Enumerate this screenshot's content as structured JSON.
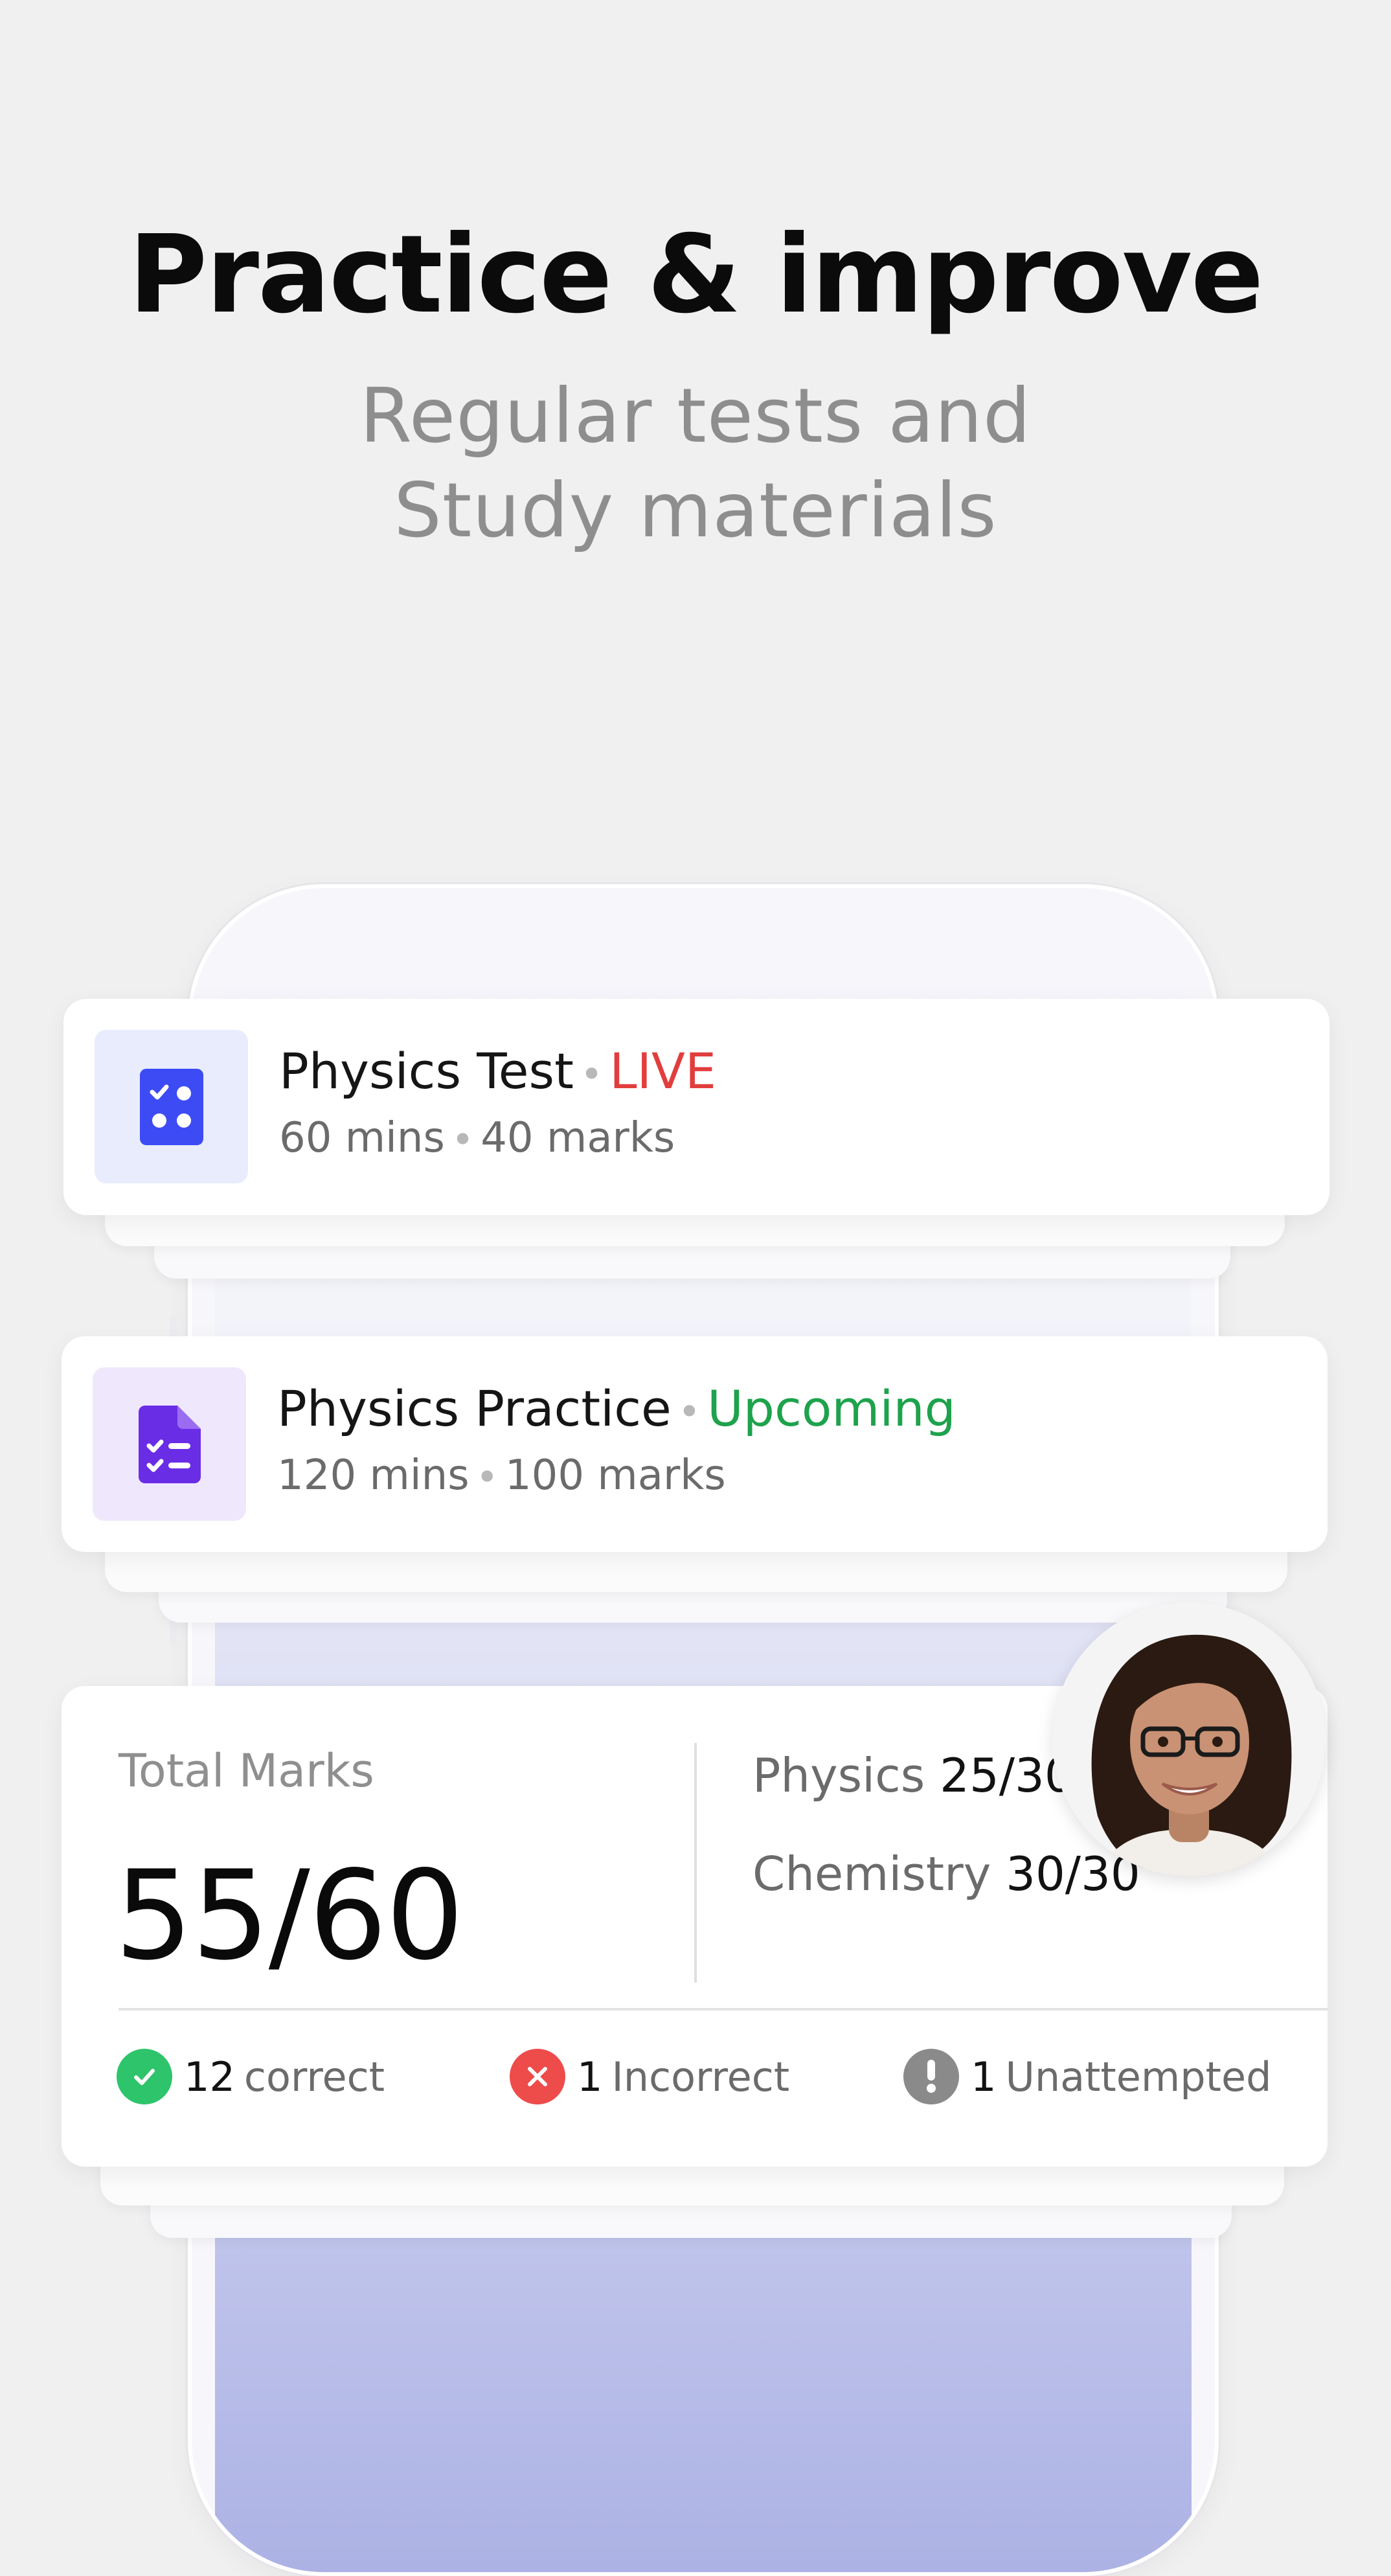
{
  "hero": {
    "title": "Practice & improve",
    "subtitle_line1": "Regular tests and",
    "subtitle_line2": "Study materials"
  },
  "tests": [
    {
      "title": "Physics Test",
      "separator": "•",
      "status": "LIVE",
      "duration": "60 mins",
      "marks": "40 marks",
      "icon": "test-grid-icon",
      "status_color": "#e23d3d"
    },
    {
      "title": "Physics Practice",
      "separator": "•",
      "status": "Upcoming",
      "duration": "120 mins",
      "marks": "100 marks",
      "icon": "checklist-document-icon",
      "status_color": "#1ea24c"
    }
  ],
  "result": {
    "label": "Total Marks",
    "score": "55/60",
    "subjects": [
      {
        "name": "Physics",
        "score": "25/30"
      },
      {
        "name": "Chemistry",
        "score": "30/30"
      }
    ],
    "stats": [
      {
        "count": "12",
        "label": "correct",
        "icon": "check-circle-icon",
        "color": "#2ec46b"
      },
      {
        "count": "1",
        "label": "Incorrect",
        "icon": "x-circle-icon",
        "color": "#ee4b4b"
      },
      {
        "count": "1",
        "label": "Unattempted",
        "icon": "exclamation-circle-icon",
        "color": "#8a8a8a"
      }
    ]
  },
  "colors": {
    "background": "#f0f0f0",
    "accent_blue": "#3d4bf5",
    "accent_purple": "#6a2de6"
  }
}
